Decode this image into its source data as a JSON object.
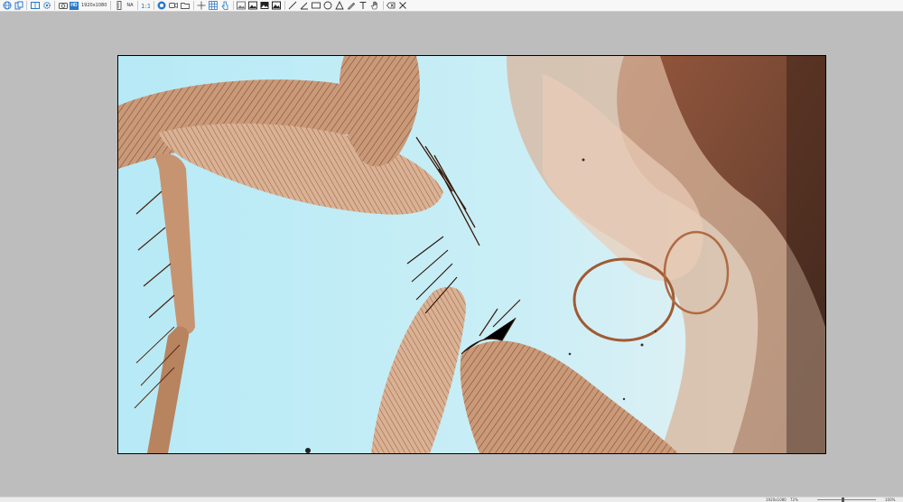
{
  "toolbar": {
    "resolution_label": "1920x1080",
    "aspect_label": "NA",
    "hd_badge": "HD"
  },
  "image": {
    "subject": "microscope image of insect leg"
  },
  "statusbar": {
    "resolution": "1920x1080",
    "zoom": "72%",
    "zoom_right": "100%"
  },
  "colors": {
    "accent": "#2b78c9",
    "background": "#bdbdbd"
  }
}
